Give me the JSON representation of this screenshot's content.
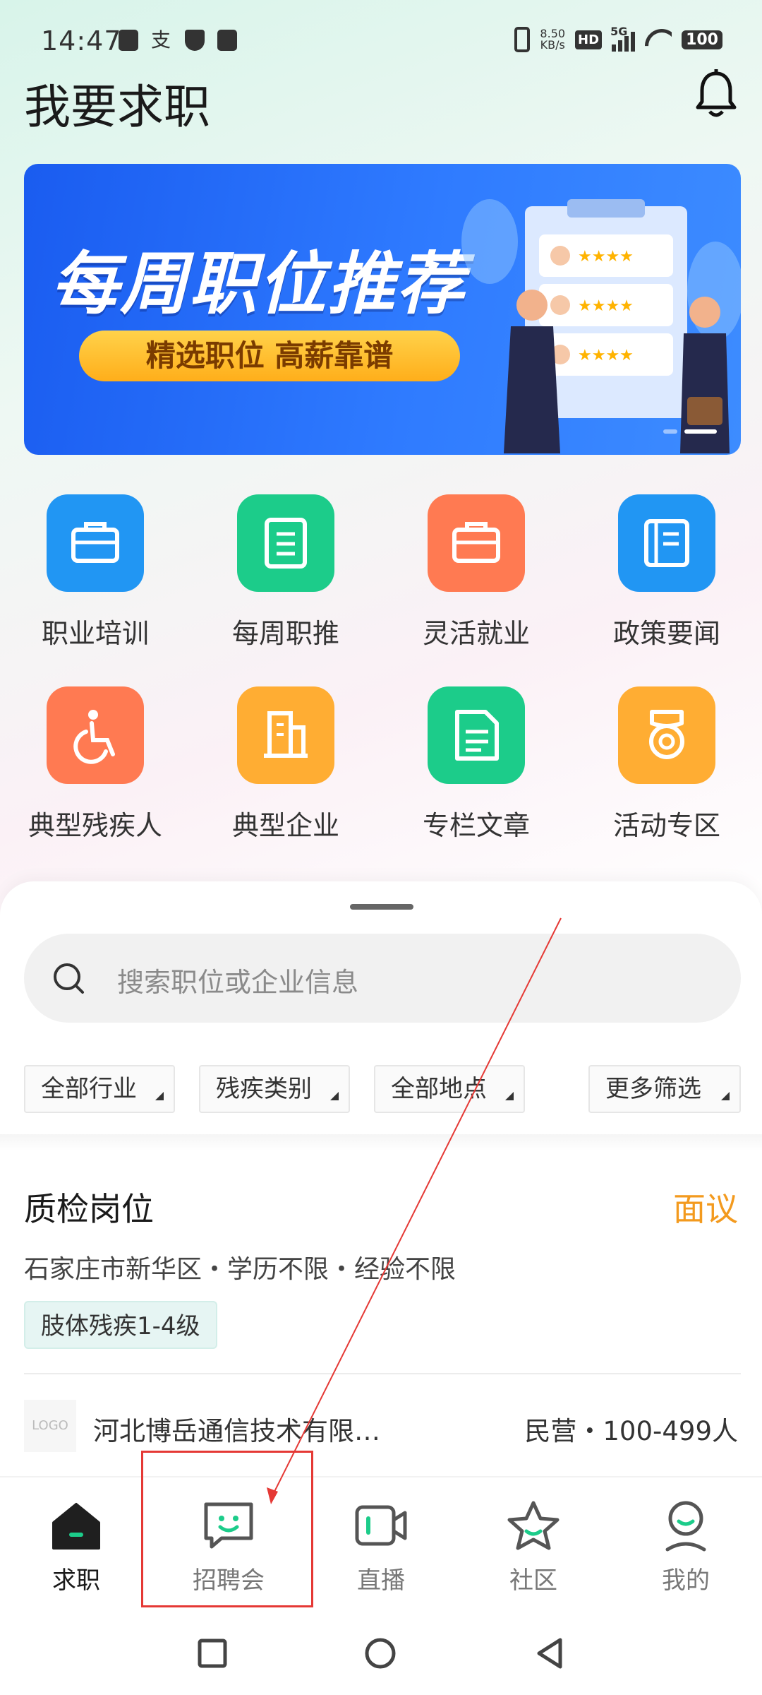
{
  "status_bar": {
    "time": "14:47",
    "net_speed_value": "8.50",
    "net_speed_unit": "KB/s",
    "hd": "HD",
    "network": "5G",
    "battery": "100",
    "left_icons": [
      "shield-check-icon",
      "alipay-icon",
      "shield-icon",
      "message-icon"
    ]
  },
  "header": {
    "title": "我要求职",
    "bell_icon": "bell-icon"
  },
  "banner": {
    "title": "每周职位推荐",
    "subtitle": "精选职位 高薪靠谱",
    "dots": 2,
    "active_dot": 2
  },
  "features": [
    {
      "label": "职业培训",
      "icon": "briefcase-icon",
      "color": "#2196f3"
    },
    {
      "label": "每周职推",
      "icon": "document-list-icon",
      "color": "#1ccc8a"
    },
    {
      "label": "灵活就业",
      "icon": "briefcase-icon",
      "color": "#ff7a52"
    },
    {
      "label": "政策要闻",
      "icon": "book-icon",
      "color": "#2196f3"
    },
    {
      "label": "典型残疾人",
      "icon": "wheelchair-icon",
      "color": "#ff7a52"
    },
    {
      "label": "典型企业",
      "icon": "building-icon",
      "color": "#ffad33"
    },
    {
      "label": "专栏文章",
      "icon": "article-icon",
      "color": "#1ccc8a"
    },
    {
      "label": "活动专区",
      "icon": "medal-icon",
      "color": "#ffad33"
    }
  ],
  "search": {
    "placeholder": "搜索职位或企业信息"
  },
  "filters": [
    "全部行业",
    "残疾类别",
    "全部地点",
    "更多筛选"
  ],
  "job": {
    "title": "质检岗位",
    "salary": "面议",
    "meta": "石家庄市新华区・学历不限・经验不限",
    "tag": "肢体残疾1-4级",
    "logo_text": "LOGO",
    "company": "河北博岳通信技术有限…",
    "company_info": "民营・100-499人"
  },
  "bottom_nav": [
    {
      "label": "求职",
      "icon": "home-icon",
      "active": true
    },
    {
      "label": "招聘会",
      "icon": "chat-smile-icon",
      "active": false
    },
    {
      "label": "直播",
      "icon": "video-icon",
      "active": false
    },
    {
      "label": "社区",
      "icon": "star-icon",
      "active": false
    },
    {
      "label": "我的",
      "icon": "profile-icon",
      "active": false
    }
  ],
  "colors": {
    "accent_green": "#1ccc8a",
    "salary_orange": "#f39a1e",
    "annotation_red": "#e53935"
  }
}
